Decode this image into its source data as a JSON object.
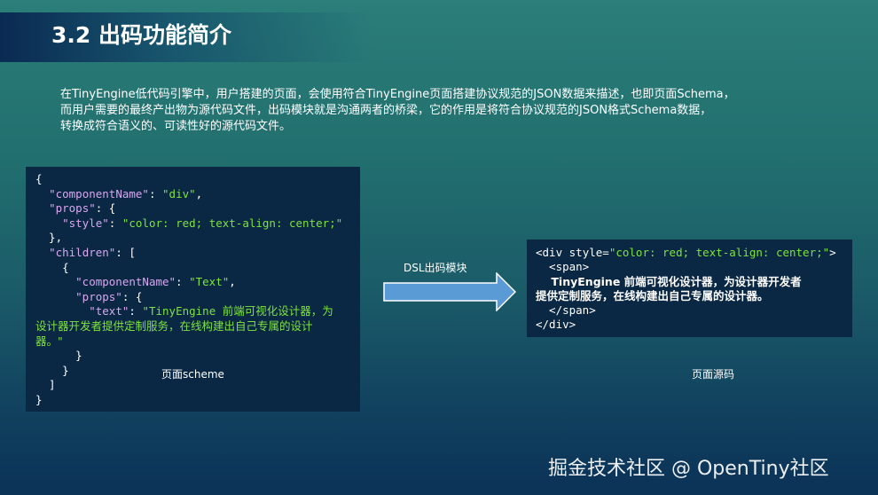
{
  "slide": {
    "title": "3.2 出码功能简介",
    "description_lines": [
      "在TinyEngine低代码引擎中，用户搭建的页面，会使用符合TinyEngine页面搭建协议规范的JSON数据来描述，也即页面Schema，",
      "而用户需要的最终产出物为源代码文件，出码模块就是沟通两者的桥梁，它的作用是将符合协议规范的JSON格式Schema数据，",
      "转换成符合语义的、可读性好的源代码文件。"
    ]
  },
  "schema_code": {
    "open_brace": "{",
    "key_componentName": "\"componentName\"",
    "val_div": "\"div\"",
    "key_props": "\"props\"",
    "key_style": "\"style\"",
    "val_style": "\"color: red; text-align: center;\"",
    "key_children": "\"children\"",
    "key_componentName2": "\"componentName\"",
    "val_text_comp": "\"Text\"",
    "key_props2": "\"props\"",
    "key_text": "\"text\"",
    "val_text_line1": "\"TinyEngine 前端可视化设计器，为",
    "val_text_line2": "设计器开发者提供定制服务，在线构建出自己专属的设计",
    "val_text_line3": "器。\"",
    "close_brace": "}"
  },
  "schema_caption": "页面scheme",
  "arrow_label": "DSL出码模块",
  "source_code": {
    "line1_tag_open": "<div ",
    "line1_attr": "style",
    "line1_val": "\"color: red; text-align: center;\"",
    "line1_end": ">",
    "line2": "  <span>",
    "text_line1": "    TinyEngine 前端可视化设计器，为设计器开发者",
    "text_line2": "提供定制服务，在线构建出自己专属的设计器。",
    "line4": "  </span>",
    "line5": "</div>"
  },
  "source_caption": "页面源码",
  "watermark": "掘金技术社区 @ OpenTiny社区",
  "colors": {
    "code_bg": "#0a2744",
    "key": "#d9a7f0",
    "string": "#7ee33d",
    "arrow_fill": "#5b9bd5"
  }
}
